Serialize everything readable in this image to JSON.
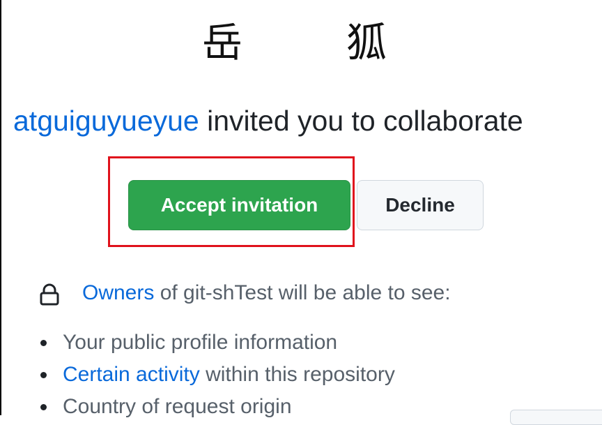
{
  "avatar": {
    "char1": "岳",
    "char2": "狐"
  },
  "invite": {
    "username": "atguiguyueyue",
    "message": " invited you to collaborate"
  },
  "actions": {
    "accept_label": "Accept invitation",
    "decline_label": "Decline"
  },
  "visibility": {
    "owners_link": "Owners",
    "owners_suffix": " of git-shTest will be able to see:",
    "items": [
      {
        "text": "Your public profile information"
      },
      {
        "link": "Certain activity",
        "text": " within this repository"
      },
      {
        "text": "Country of request origin"
      }
    ]
  },
  "colors": {
    "accent_link": "#0969da",
    "accept_green": "#2da44e",
    "highlight_red": "#e0121c"
  },
  "icons": {
    "lock": "lock-icon"
  }
}
